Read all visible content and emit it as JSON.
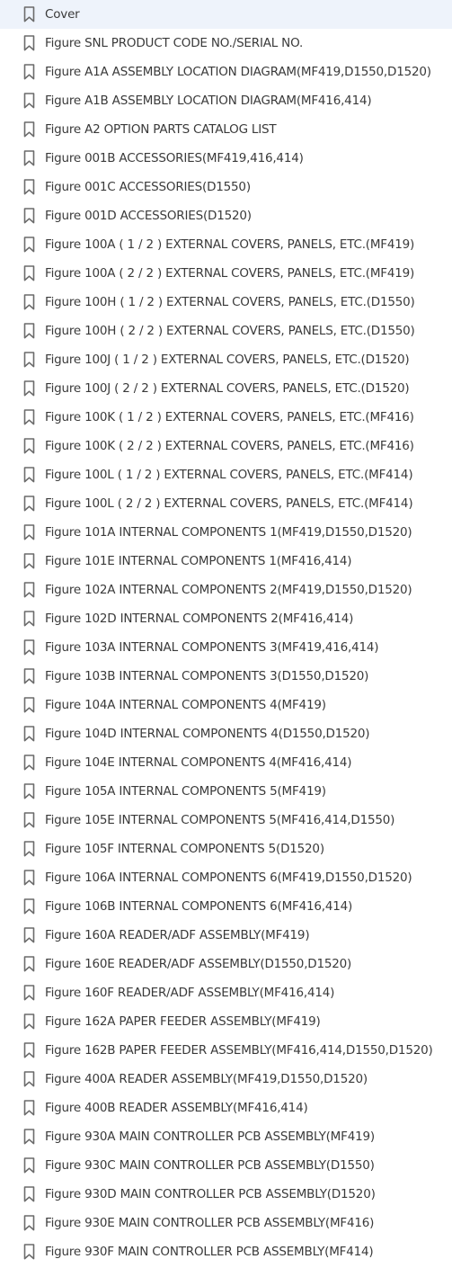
{
  "bookmarks": {
    "items": [
      {
        "label": "Cover"
      },
      {
        "label": "Figure SNL PRODUCT CODE NO./SERIAL NO."
      },
      {
        "label": "Figure A1A ASSEMBLY LOCATION DIAGRAM(MF419,D1550,D1520)"
      },
      {
        "label": "Figure A1B ASSEMBLY LOCATION DIAGRAM(MF416,414)"
      },
      {
        "label": "Figure A2 OPTION PARTS CATALOG LIST"
      },
      {
        "label": "Figure 001B ACCESSORIES(MF419,416,414)"
      },
      {
        "label": "Figure 001C ACCESSORIES(D1550)"
      },
      {
        "label": "Figure 001D ACCESSORIES(D1520)"
      },
      {
        "label": "Figure 100A ( 1 / 2 ) EXTERNAL COVERS, PANELS, ETC.(MF419)"
      },
      {
        "label": "Figure 100A ( 2 / 2 ) EXTERNAL COVERS, PANELS, ETC.(MF419)"
      },
      {
        "label": "Figure 100H ( 1 / 2 ) EXTERNAL COVERS, PANELS, ETC.(D1550)"
      },
      {
        "label": "Figure 100H ( 2 / 2 ) EXTERNAL COVERS, PANELS, ETC.(D1550)"
      },
      {
        "label": "Figure 100J ( 1 / 2 ) EXTERNAL COVERS, PANELS, ETC.(D1520)"
      },
      {
        "label": "Figure 100J ( 2 / 2 ) EXTERNAL COVERS, PANELS, ETC.(D1520)"
      },
      {
        "label": "Figure 100K ( 1 / 2 ) EXTERNAL COVERS, PANELS, ETC.(MF416)"
      },
      {
        "label": "Figure 100K ( 2 / 2 ) EXTERNAL COVERS, PANELS, ETC.(MF416)"
      },
      {
        "label": "Figure 100L ( 1 / 2 ) EXTERNAL COVERS, PANELS, ETC.(MF414)"
      },
      {
        "label": "Figure 100L ( 2 / 2 ) EXTERNAL COVERS, PANELS, ETC.(MF414)"
      },
      {
        "label": "Figure 101A INTERNAL COMPONENTS 1(MF419,D1550,D1520)"
      },
      {
        "label": "Figure 101E INTERNAL COMPONENTS 1(MF416,414)"
      },
      {
        "label": "Figure 102A INTERNAL COMPONENTS 2(MF419,D1550,D1520)"
      },
      {
        "label": "Figure 102D INTERNAL COMPONENTS 2(MF416,414)"
      },
      {
        "label": "Figure 103A INTERNAL COMPONENTS 3(MF419,416,414)"
      },
      {
        "label": "Figure 103B INTERNAL COMPONENTS 3(D1550,D1520)"
      },
      {
        "label": "Figure 104A INTERNAL COMPONENTS 4(MF419)"
      },
      {
        "label": "Figure 104D INTERNAL COMPONENTS 4(D1550,D1520)"
      },
      {
        "label": "Figure 104E INTERNAL COMPONENTS 4(MF416,414)"
      },
      {
        "label": "Figure 105A INTERNAL COMPONENTS 5(MF419)"
      },
      {
        "label": "Figure 105E INTERNAL COMPONENTS 5(MF416,414,D1550)"
      },
      {
        "label": "Figure 105F INTERNAL COMPONENTS 5(D1520)"
      },
      {
        "label": "Figure 106A INTERNAL COMPONENTS 6(MF419,D1550,D1520)"
      },
      {
        "label": "Figure 106B INTERNAL COMPONENTS 6(MF416,414)"
      },
      {
        "label": "Figure 160A READER/ADF ASSEMBLY(MF419)"
      },
      {
        "label": "Figure 160E READER/ADF ASSEMBLY(D1550,D1520)"
      },
      {
        "label": "Figure 160F READER/ADF ASSEMBLY(MF416,414)"
      },
      {
        "label": "Figure 162A PAPER FEEDER ASSEMBLY(MF419)"
      },
      {
        "label": "Figure 162B PAPER FEEDER ASSEMBLY(MF416,414,D1550,D1520)"
      },
      {
        "label": "Figure 400A READER ASSEMBLY(MF419,D1550,D1520)"
      },
      {
        "label": "Figure 400B READER ASSEMBLY(MF416,414)"
      },
      {
        "label": "Figure 930A MAIN CONTROLLER PCB ASSEMBLY(MF419)"
      },
      {
        "label": "Figure 930C MAIN CONTROLLER PCB ASSEMBLY(D1550)"
      },
      {
        "label": "Figure 930D MAIN CONTROLLER PCB ASSEMBLY(D1520)"
      },
      {
        "label": "Figure 930E MAIN CONTROLLER PCB ASSEMBLY(MF416)"
      },
      {
        "label": "Figure 930F MAIN CONTROLLER PCB ASSEMBLY(MF414)"
      }
    ],
    "icon": "bookmark-icon",
    "icon_color": "#6b6b6b",
    "text_color": "#3a3a3a"
  }
}
